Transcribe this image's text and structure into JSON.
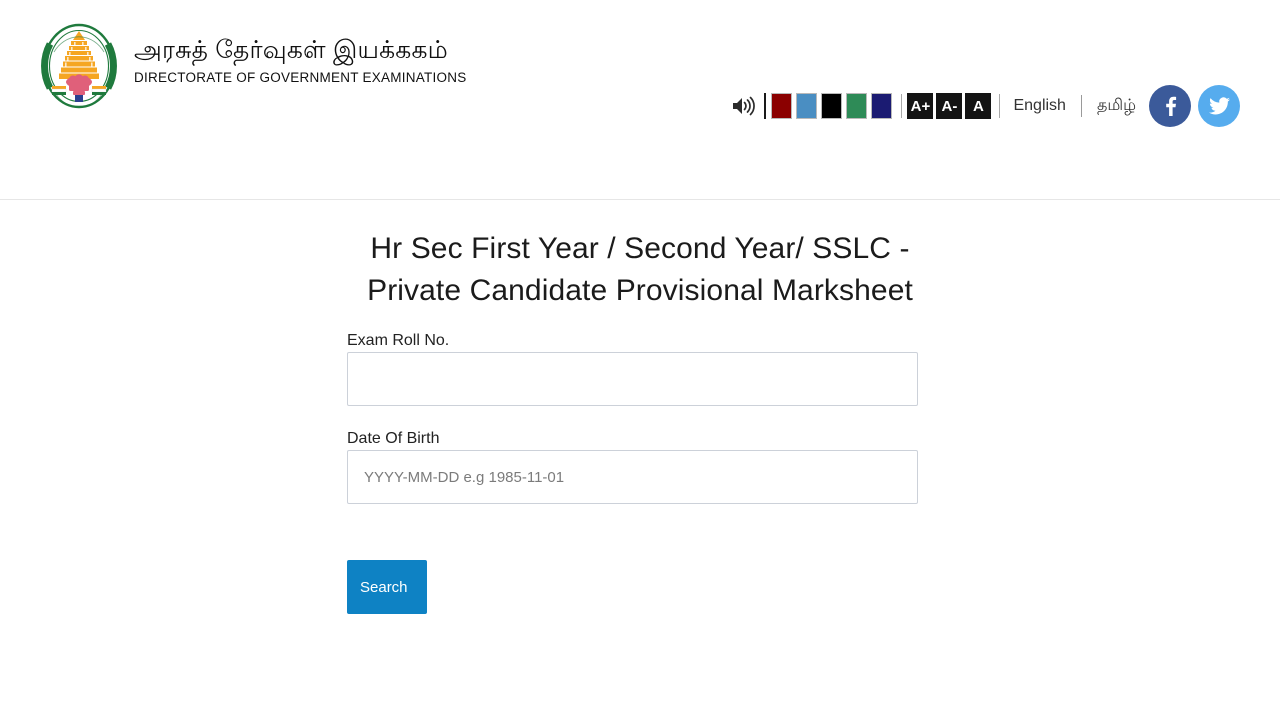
{
  "header": {
    "logo_icon": "tamil-nadu-government-emblem",
    "brand_tamil": "அரசுத் தேர்வுகள் இயக்ககம்",
    "brand_english": "DIRECTORATE OF GOVERNMENT EXAMINATIONS",
    "accessibility": {
      "speaker_icon": "speaker-volume-icon",
      "theme_swatches": [
        {
          "name": "dark-red",
          "color": "#8B0000"
        },
        {
          "name": "steel-blue",
          "color": "#4a8ec2"
        },
        {
          "name": "black",
          "color": "#000000"
        },
        {
          "name": "sea-green",
          "color": "#2e8b57"
        },
        {
          "name": "navy",
          "color": "#1b1b72"
        }
      ],
      "font_buttons": [
        {
          "name": "increase-font",
          "label": "A+"
        },
        {
          "name": "decrease-font",
          "label": "A-"
        },
        {
          "name": "reset-font",
          "label": "A"
        }
      ]
    },
    "languages": [
      {
        "name": "english",
        "label": "English"
      },
      {
        "name": "tamil",
        "label": "தமிழ்"
      }
    ],
    "social": [
      {
        "name": "facebook",
        "glyph": "f",
        "color": "#3b5a9a"
      },
      {
        "name": "twitter",
        "glyph": "twitter-bird-icon",
        "color": "#56acee"
      }
    ]
  },
  "main": {
    "title": "Hr Sec First Year / Second Year/ SSLC - Private Candidate Provisional Marksheet",
    "fields": {
      "roll_no": {
        "label": "Exam Roll No.",
        "value": "",
        "placeholder": ""
      },
      "dob": {
        "label": "Date Of Birth",
        "value": "",
        "placeholder": "YYYY-MM-DD e.g 1985-11-01"
      }
    },
    "search_button": {
      "label": "Search",
      "color": "#0e82c4"
    }
  }
}
